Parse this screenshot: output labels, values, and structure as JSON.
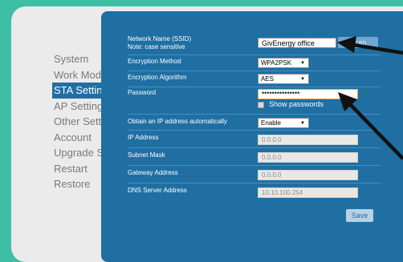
{
  "nav": {
    "items": [
      {
        "label": "System"
      },
      {
        "label": "Work Mode"
      },
      {
        "label": "STA Setting"
      },
      {
        "label": "AP Setting"
      },
      {
        "label": "Other Setting"
      },
      {
        "label": "Account"
      },
      {
        "label": "Upgrade SW"
      },
      {
        "label": "Restart"
      },
      {
        "label": "Restore"
      }
    ],
    "active": "STA Setting"
  },
  "form": {
    "ssid": {
      "label": "Network Name (SSID)",
      "note": "Note: case sensitive",
      "value": "GivEnergy office",
      "scan_label": "Scan"
    },
    "encryption_method": {
      "label": "Encryption Method",
      "value": "WPA2PSK"
    },
    "encryption_algorithm": {
      "label": "Encryption Algorithm",
      "value": "AES"
    },
    "password": {
      "label": "Password",
      "value": "•••••••••••••••",
      "show_label": "Show passwords"
    },
    "dhcp": {
      "label": "Obtain an IP address automatically",
      "value": "Enable"
    },
    "ip_address": {
      "label": "IP Address",
      "value": "0.0.0.0"
    },
    "subnet_mask": {
      "label": "Subnet Mask",
      "value": "0.0.0.0"
    },
    "gateway": {
      "label": "Gateway Address",
      "value": "0.0.0.0"
    },
    "dns": {
      "label": "DNS Server Address",
      "value": "10.10.100.254"
    },
    "save_label": "Save"
  },
  "colors": {
    "background": "#3dbfa6",
    "panel": "#1f6fa3",
    "annotation_arrow": "#111111"
  }
}
